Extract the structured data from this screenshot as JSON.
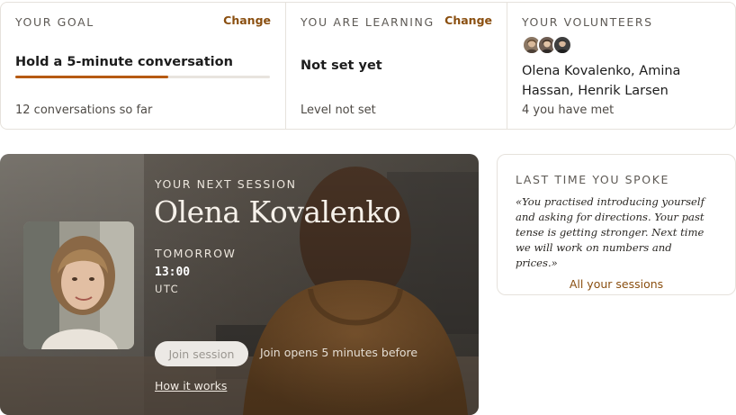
{
  "goal": {
    "label": "YOUR GOAL",
    "change_label": "Change",
    "title": "Hold a 5-minute conversation",
    "progress_fraction": 0.6,
    "subtitle": "12 conversations so far"
  },
  "learning": {
    "label": "YOU ARE LEARNING",
    "change_label": "Change",
    "title": "Not set yet",
    "subtitle": "Level not set"
  },
  "volunteers": {
    "label": "YOUR VOLUNTEERS",
    "names": "Olena Kovalenko, Amina Hassan, Henrik Larsen",
    "subtitle": "4 you have met",
    "avatars": [
      "avatar-olena",
      "avatar-amina",
      "avatar-henrik"
    ]
  },
  "session": {
    "label": "YOUR NEXT SESSION",
    "name": "Olena Kovalenko",
    "when": "TOMORROW",
    "time": "13:00",
    "timezone": "UTC",
    "join_label": "Join session",
    "join_note": "Join opens 5 minutes before",
    "how_label": "How it works"
  },
  "last_time": {
    "label": "LAST TIME YOU SPOKE",
    "quote": "«You practised introducing yourself and asking for directions. Your past tense is getting stronger. Next time we will work on numbers and prices.»",
    "link_label": "All your sessions"
  },
  "colors": {
    "accent": "#8a4f10",
    "progress": "#b65a12",
    "border": "#e6e2dc"
  }
}
